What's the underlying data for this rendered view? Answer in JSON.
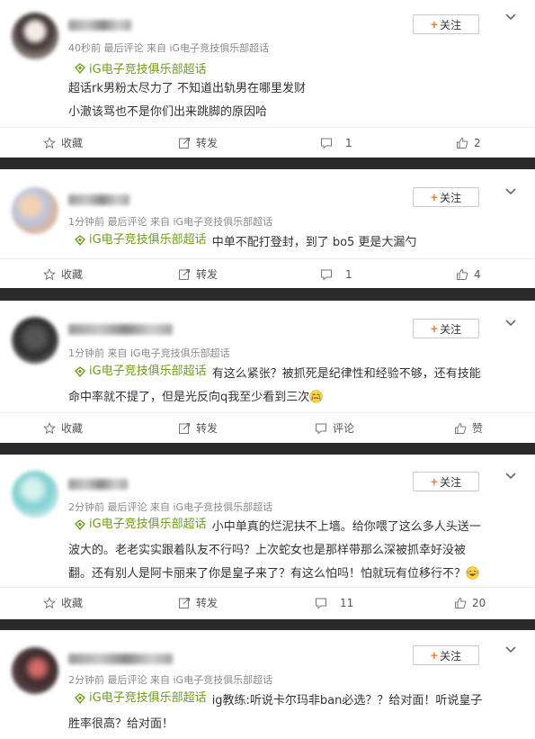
{
  "colors": {
    "topic_green": "#6e9c1d",
    "follow_plus": "#fa7d3c",
    "background_dark": "#2b2b2b"
  },
  "follow_label": "关注",
  "topic_label": "iG电子竞技俱乐部超话",
  "posts": [
    {
      "meta": "40秒前  最后评论  来自 iG电子竞技俱乐部超话",
      "lines": [
        "超话rk男粉太尽力了 不知道出轨男在哪里发财",
        "小澈该骂也不是你们出来跳脚的原因哈"
      ],
      "actions": {
        "collect": "收藏",
        "repost": "转发",
        "comment": "1",
        "like": "2"
      }
    },
    {
      "meta": "1分钟前  最后评论  来自 iG电子竞技俱乐部超话",
      "lines": [
        "中单不配打登封，到了 bo5 更是大漏勺"
      ],
      "actions": {
        "collect": "收藏",
        "repost": "转发",
        "comment": "1",
        "like": "4"
      }
    },
    {
      "meta": "1分钟前  来自 iG电子竞技俱乐部超话",
      "lines": [
        "有这么紧张？被抓死是纪律性和经验不够，还有技能",
        "命中率就不提了，但是光反向q我至少看到三次"
      ],
      "actions": {
        "collect": "收藏",
        "repost": "转发",
        "comment": "评论",
        "like": "赞"
      }
    },
    {
      "meta": "2分钟前  最后评论  来自 iG电子竞技俱乐部超话",
      "lines": [
        "小中单真的烂泥扶不上墙。给你喂了这么多人头送一",
        "波大的。老老实实跟着队友不行吗？上次蛇女也是那样带那么深被抓幸好没被",
        "翻。还有别人是阿卡丽来了你是皇子来了？有这么怕吗！怕就玩有位移行不？"
      ],
      "actions": {
        "collect": "收藏",
        "repost": "转发",
        "comment": "11",
        "like": "20"
      }
    },
    {
      "meta": "2分钟前  最后评论  来自 iG电子竞技俱乐部超话",
      "lines": [
        "ig教练:听说卡尔玛非ban必选？？给对面！听说皇子",
        "胜率很高？给对面！"
      ],
      "actions": {}
    }
  ]
}
